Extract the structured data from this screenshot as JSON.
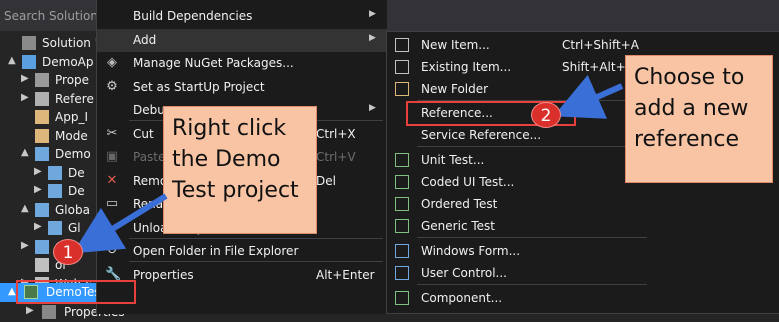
{
  "search": {
    "placeholder": "Search Solution Ex"
  },
  "tree": [
    {
      "text": "Solution 'De",
      "chevron": "",
      "icon": "solution",
      "indent": 0
    },
    {
      "text": "DemoAp",
      "chevron": "▲",
      "icon": "web-project",
      "indent": 0
    },
    {
      "text": "Prope",
      "chevron": "▶",
      "icon": "wrench",
      "indent": 1
    },
    {
      "text": "Refere",
      "chevron": "▶",
      "icon": "references",
      "indent": 1
    },
    {
      "text": "App_I",
      "chevron": "",
      "icon": "folder",
      "indent": 1
    },
    {
      "text": "Mode",
      "chevron": "",
      "icon": "folder",
      "indent": 1
    },
    {
      "text": "Demo",
      "chevron": "▲",
      "icon": "file",
      "indent": 1
    },
    {
      "text": "De",
      "chevron": "▶",
      "icon": "file",
      "indent": 2
    },
    {
      "text": "De",
      "chevron": "▶",
      "icon": "file",
      "indent": 2
    },
    {
      "text": "Globa",
      "chevron": "▲",
      "icon": "file",
      "indent": 1
    },
    {
      "text": "Gl",
      "chevron": "▶",
      "icon": "file",
      "indent": 2
    },
    {
      "text": "Gur",
      "chevron": "▶",
      "icon": "globe",
      "indent": 1
    },
    {
      "text": "or",
      "chevron": "",
      "icon": "config",
      "indent": 1
    },
    {
      "text": "Web.c",
      "chevron": "▶",
      "icon": "config",
      "indent": 1
    }
  ],
  "selected_project": "DemoTest",
  "below_selected": "Properties",
  "context_menu": {
    "items": [
      {
        "label": "Build Dependencies",
        "shortcut": "",
        "submenu": true,
        "icon": ""
      },
      {
        "label": "Add",
        "shortcut": "",
        "submenu": true,
        "icon": "",
        "highlighted": true
      },
      {
        "label": "Manage NuGet Packages...",
        "shortcut": "",
        "submenu": false,
        "icon": "nuget"
      },
      {
        "label": "Set as StartUp Project",
        "shortcut": "",
        "submenu": false,
        "icon": "gear"
      },
      {
        "label": "Debug",
        "shortcut": "",
        "submenu": true,
        "icon": ""
      },
      {
        "label": "Cut",
        "shortcut": "Ctrl+X",
        "submenu": false,
        "icon": "scissors"
      },
      {
        "label": "Paste",
        "shortcut": "Ctrl+V",
        "submenu": false,
        "icon": "paste",
        "disabled": true
      },
      {
        "label": "Remove",
        "shortcut": "Del",
        "submenu": false,
        "icon": "x"
      },
      {
        "label": "Rename",
        "shortcut": "",
        "submenu": false,
        "icon": "rename"
      },
      {
        "label": "Unload Project",
        "shortcut": "",
        "submenu": false,
        "icon": ""
      },
      {
        "label": "Open Folder in File Explorer",
        "shortcut": "",
        "submenu": false,
        "icon": "open-folder"
      },
      {
        "label": "Properties",
        "shortcut": "Alt+Enter",
        "submenu": false,
        "icon": "wrench"
      }
    ]
  },
  "add_submenu": {
    "items": [
      {
        "label": "New Item...",
        "shortcut": "Ctrl+Shift+A",
        "icon": "new-item"
      },
      {
        "label": "Existing Item...",
        "shortcut": "Shift+Alt+A",
        "icon": "existing-item"
      },
      {
        "label": "New Folder",
        "shortcut": "",
        "icon": "new-folder"
      },
      {
        "label": "Reference...",
        "shortcut": "",
        "icon": "",
        "highlighted": true
      },
      {
        "label": "Service Reference...",
        "shortcut": "",
        "icon": ""
      },
      {
        "label": "Unit Test...",
        "shortcut": "",
        "icon": "test"
      },
      {
        "label": "Coded UI Test...",
        "shortcut": "",
        "icon": "test"
      },
      {
        "label": "Ordered Test",
        "shortcut": "",
        "icon": "test"
      },
      {
        "label": "Generic Test",
        "shortcut": "",
        "icon": "test"
      },
      {
        "label": "Windows Form...",
        "shortcut": "",
        "icon": "form"
      },
      {
        "label": "User Control...",
        "shortcut": "",
        "icon": "user-control"
      },
      {
        "label": "Component...",
        "shortcut": "",
        "icon": "component"
      }
    ]
  },
  "annotations": {
    "callout1": [
      "Right click",
      "the Demo",
      "Test project"
    ],
    "callout2": [
      "Choose to",
      "add a new",
      "reference"
    ],
    "badge1": "1",
    "badge2": "2"
  },
  "colors": {
    "accent": "#3399ff",
    "callout": "#f8c4a4",
    "badge": "#d9302b",
    "arrow": "#3a6fd8"
  }
}
